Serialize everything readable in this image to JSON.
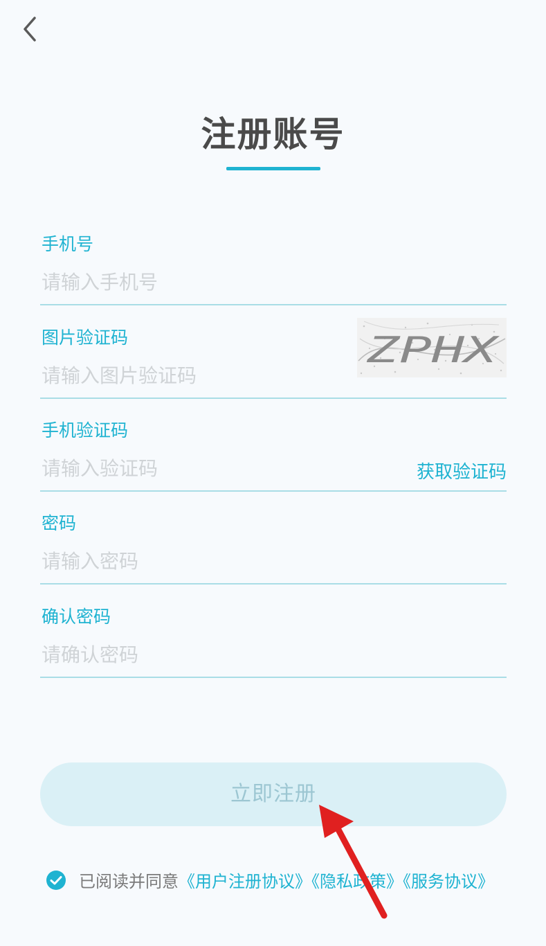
{
  "header": {
    "back_icon": "chevron-left-icon",
    "title": "注册账号"
  },
  "fields": [
    {
      "label": "手机号",
      "placeholder": "请输入手机号",
      "value": ""
    },
    {
      "label": "图片验证码",
      "placeholder": "请输入图片验证码",
      "value": "",
      "captcha_text": "ZPHX"
    },
    {
      "label": "手机验证码",
      "placeholder": "请输入验证码",
      "value": "",
      "action_label": "获取验证码"
    },
    {
      "label": "密码",
      "placeholder": "请输入密码",
      "value": ""
    },
    {
      "label": "确认密码",
      "placeholder": "请确认密码",
      "value": ""
    }
  ],
  "register_button": {
    "label": "立即注册"
  },
  "agreement": {
    "checked": true,
    "prefix": "已阅读并同意",
    "links": [
      "《用户注册协议》",
      "《隐私政策》",
      "《服务协议》"
    ]
  },
  "colors": {
    "accent": "#1fb3d1",
    "button_bg": "#daf0f6",
    "button_text": "#9cc6d2",
    "placeholder": "#cfd3d6",
    "annotation_arrow": "#e02020"
  }
}
